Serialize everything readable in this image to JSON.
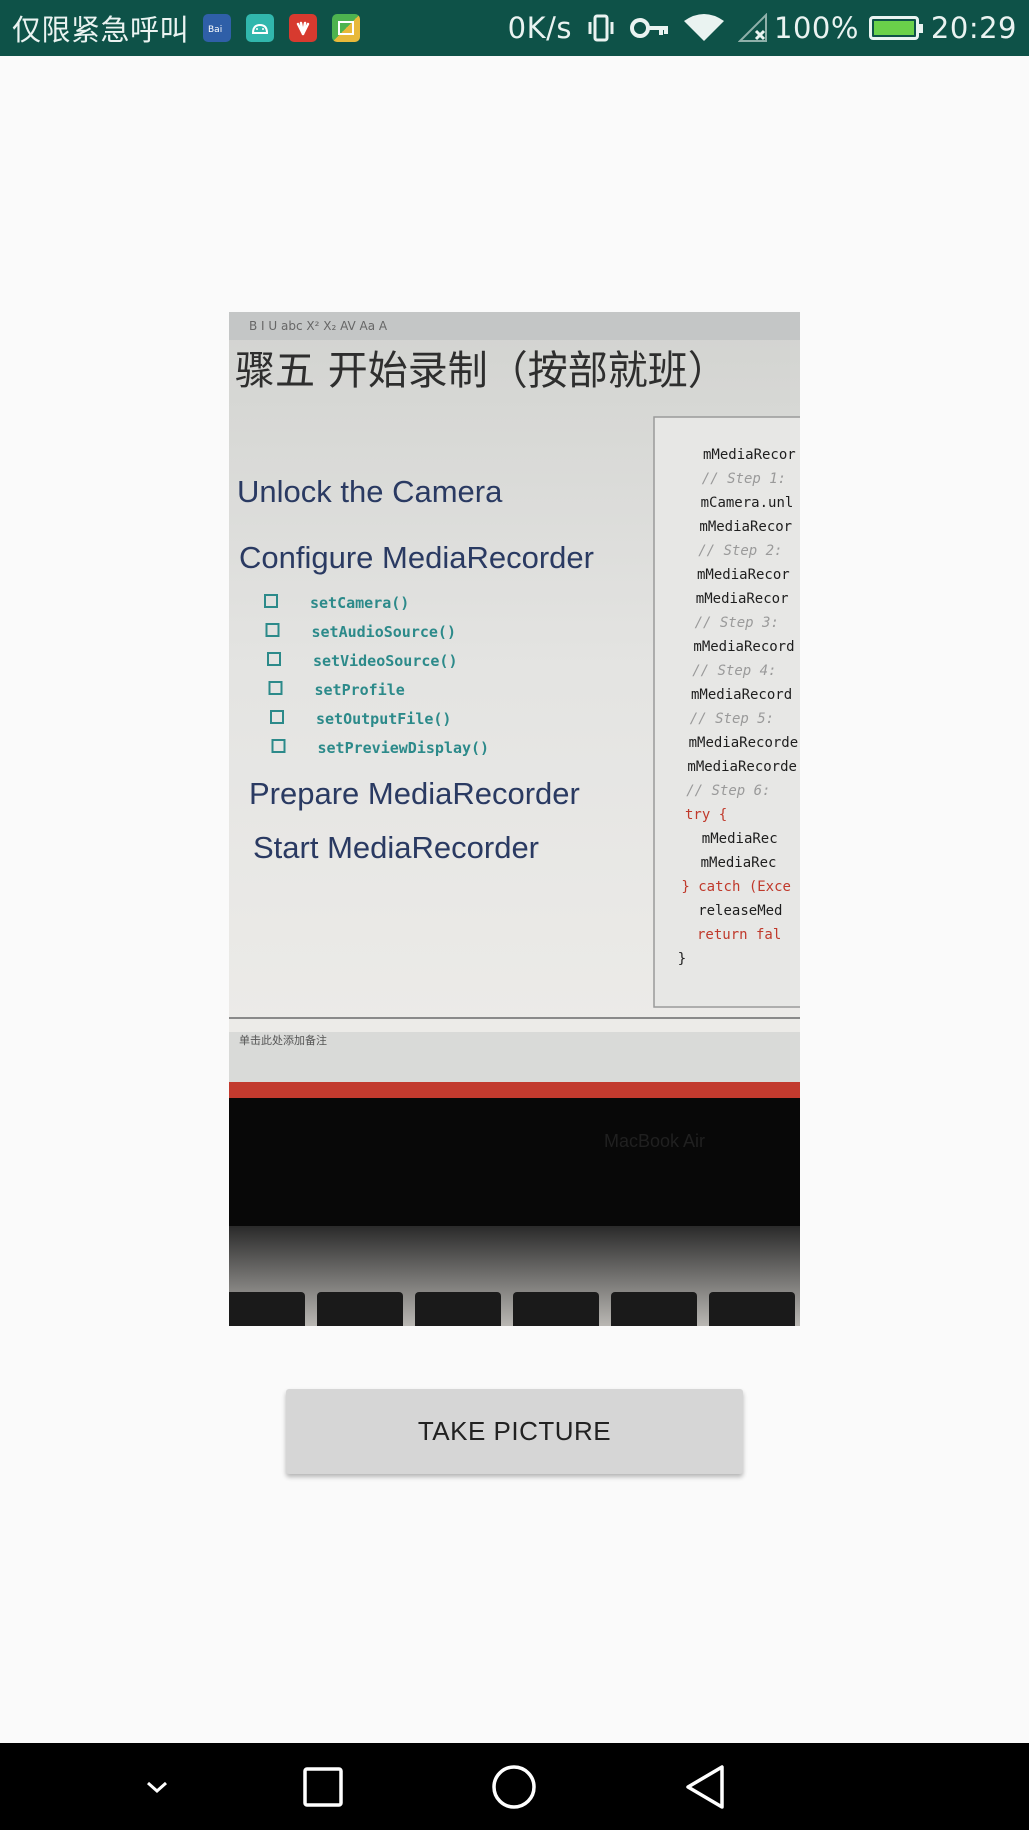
{
  "status_bar": {
    "carrier_text": "仅限紧急呼叫",
    "notification_icons": [
      "baidu-app-icon",
      "android-debug-icon",
      "huawei-icon",
      "photos-app-icon"
    ],
    "network_speed": "0K/s",
    "battery_percent": "100%",
    "time": "20:29",
    "battery_level": 1.0
  },
  "camera_preview": {
    "slide_heading": "骤五 开始录制（按部就班）",
    "items": [
      "Unlock the Camera",
      "Configure MediaRecorder",
      "Prepare MediaRecorder",
      "Start MediaRecorder"
    ],
    "sub_items": [
      "setCamera()",
      "setAudioSource()",
      "setVideoSource()",
      "setProfile",
      "setOutputFile()",
      "setPreviewDisplay()"
    ],
    "code_lines": [
      "mMediaRecor",
      "// Step 1:",
      "mCamera.unl",
      "mMediaRecor",
      "// Step 2:",
      "mMediaRecor",
      "mMediaRecor",
      "// Step 3:",
      "mMediaRecord",
      "// Step 4:",
      "mMediaRecord",
      "// Step 5:",
      "mMediaRecorde",
      "mMediaRecorde",
      "// Step 6:",
      "try {",
      "mMediaRec",
      "mMediaRec",
      "} catch (Exce",
      "releaseMed",
      "return fal",
      "}"
    ],
    "notes_text": "单击此处添加备注",
    "laptop_label": "MacBook Air"
  },
  "actions": {
    "take_picture_label": "TAKE PICTURE"
  },
  "nav_bar": {
    "buttons": [
      "chevron-down-icon",
      "recents-square-icon",
      "home-circle-icon",
      "back-triangle-icon"
    ]
  },
  "colors": {
    "status_bar_bg": "#0e5248",
    "button_bg": "#d6d6d6",
    "page_bg": "#fafafa"
  }
}
